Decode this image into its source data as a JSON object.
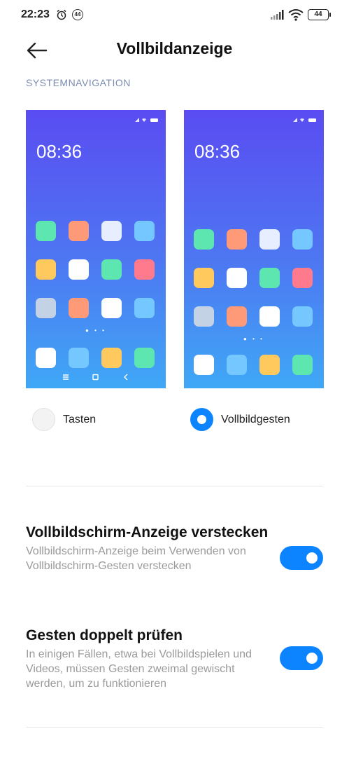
{
  "status_bar": {
    "time": "22:23",
    "notification_badge": "44",
    "battery": "44"
  },
  "header": {
    "back_icon": "arrow-left-icon",
    "title": "Vollbildanzeige"
  },
  "section": {
    "label": "SYSTEMNAVIGATION"
  },
  "previews": {
    "left_clock": "08:36",
    "right_clock": "08:36",
    "left_rows": [
      [
        "#5ee6b0",
        "#ff9a78",
        "#e6eeff",
        "#74c7ff"
      ],
      [
        "#ffc95e",
        "#ffffff",
        "#5ee6b0",
        "#ff7a8c"
      ],
      [
        "#c4d2e6",
        "#ff9a78",
        "#ffffff",
        "#74c7ff"
      ]
    ],
    "left_dock": [
      "#ffffff",
      "#74c7ff",
      "#ffc95e",
      "#5ee6b0"
    ],
    "right_rows": [
      [
        "#5ee6b0",
        "#ff9a78",
        "#e6eeff",
        "#74c7ff"
      ],
      [
        "#ffc95e",
        "#ffffff",
        "#5ee6b0",
        "#ff7a8c"
      ],
      [
        "#c4d2e6",
        "#ff9a78",
        "#ffffff",
        "#74c7ff"
      ]
    ],
    "right_dock": [
      "#ffffff",
      "#74c7ff",
      "#ffc95e",
      "#5ee6b0"
    ],
    "nav_icons": [
      "menu-icon",
      "home-square-icon",
      "back-chevron-icon"
    ]
  },
  "options": {
    "buttons_label": "Tasten",
    "buttons_selected": false,
    "gestures_label": "Vollbildgesten",
    "gestures_selected": true
  },
  "settings": [
    {
      "title": "Vollbildschirm-Anzeige verstecken",
      "subtitle": "Vollbildschirm-Anzeige beim Verwenden von Vollbildschirm-Gesten verstecken",
      "enabled": true
    },
    {
      "title": "Gesten doppelt prüfen",
      "subtitle": "In einigen Fällen, etwa bei Vollbildspielen und Videos, müssen Gesten zweimal gewischt werden, um zu funktionieren",
      "enabled": true
    }
  ],
  "colors": {
    "accent": "#0d84ff",
    "section_label": "#7a8cb0",
    "gradient_top": "#5a4cf2",
    "gradient_bottom": "#3fa8f6"
  }
}
